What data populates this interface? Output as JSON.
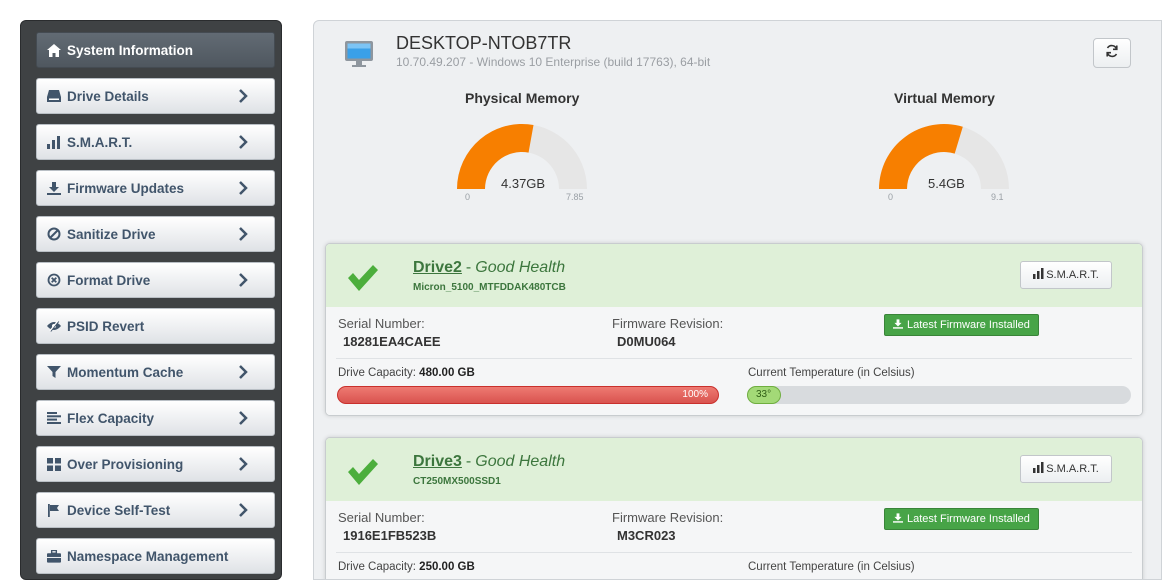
{
  "sidebar": {
    "items": [
      {
        "label": "System Information",
        "icon": "home-icon",
        "active": true
      },
      {
        "label": "Drive Details",
        "icon": "drive-icon"
      },
      {
        "label": "S.M.A.R.T.",
        "icon": "bar-chart-icon"
      },
      {
        "label": "Firmware Updates",
        "icon": "download-icon"
      },
      {
        "label": "Sanitize Drive",
        "icon": "ban-icon"
      },
      {
        "label": "Format Drive",
        "icon": "times-circle-icon"
      },
      {
        "label": "PSID Revert",
        "icon": "eye-slash-icon"
      },
      {
        "label": "Momentum Cache",
        "icon": "filter-icon"
      },
      {
        "label": "Flex Capacity",
        "icon": "align-left-icon"
      },
      {
        "label": "Over Provisioning",
        "icon": "grid-icon"
      },
      {
        "label": "Device Self-Test",
        "icon": "flag-icon"
      },
      {
        "label": "Namespace Management",
        "icon": "briefcase-icon"
      }
    ]
  },
  "system": {
    "hostname": "DESKTOP-NTOB7TR",
    "details": "10.70.49.207 - Windows 10 Enterprise (build 17763), 64-bit"
  },
  "memory": {
    "physical": {
      "title": "Physical Memory",
      "value_label": "4.37GB",
      "value": 4.37,
      "min": "0",
      "max": "7.85",
      "max_value": 7.85
    },
    "virtual": {
      "title": "Virtual Memory",
      "value_label": "5.4GB",
      "value": 5.4,
      "min": "0",
      "max": "9.1",
      "max_value": 9.1
    }
  },
  "colors": {
    "gauge_fill": "#f77f00",
    "gauge_track": "#e6e6e6",
    "health_green": "#3c763d",
    "capacity_red": "#d9534f",
    "temp_green": "#a3d977"
  },
  "drives": [
    {
      "name": "Drive2",
      "separator": "-",
      "health": "Good Health",
      "model": "Micron_5100_MTFDDAK480TCB",
      "smart_label": "S.M.A.R.T.",
      "serial_label": "Serial Number:",
      "serial": "18281EA4CAEE",
      "firmware_label": "Firmware Revision:",
      "firmware": "D0MU064",
      "firmware_status": "Latest Firmware Installed",
      "capacity_label": "Drive Capacity:",
      "capacity": "480.00 GB",
      "capacity_used": "100%",
      "temp_label": "Current Temperature (in Celsius)",
      "temperature": "33°"
    },
    {
      "name": "Drive3",
      "separator": "-",
      "health": "Good Health",
      "model": "CT250MX500SSD1",
      "smart_label": "S.M.A.R.T.",
      "serial_label": "Serial Number:",
      "serial": "1916E1FB523B",
      "firmware_label": "Firmware Revision:",
      "firmware": "M3CR023",
      "firmware_status": "Latest Firmware Installed",
      "capacity_label": "Drive Capacity:",
      "capacity": "250.00 GB",
      "temp_label": "Current Temperature (in Celsius)"
    }
  ]
}
